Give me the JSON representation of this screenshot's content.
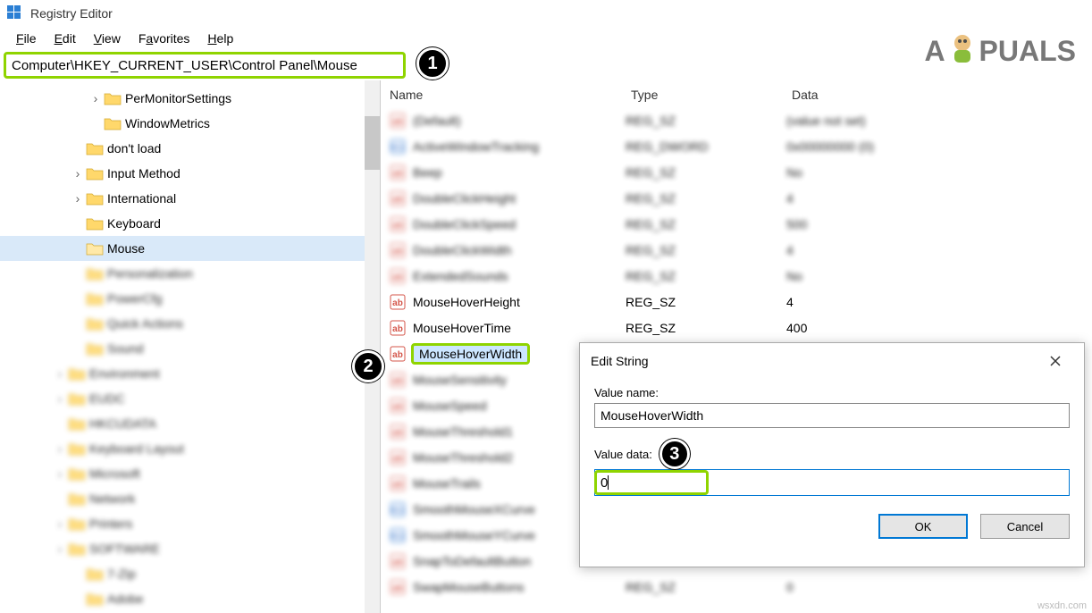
{
  "app": {
    "title": "Registry Editor",
    "address": "Computer\\HKEY_CURRENT_USER\\Control Panel\\Mouse"
  },
  "menu": {
    "file": "File",
    "edit": "Edit",
    "view": "View",
    "favorites": "Favorites",
    "help": "Help"
  },
  "tree": {
    "items": [
      {
        "label": "PerMonitorSettings",
        "indent": 100,
        "expandable": true
      },
      {
        "label": "WindowMetrics",
        "indent": 100
      },
      {
        "label": "don't load",
        "indent": 80
      },
      {
        "label": "Input Method",
        "indent": 80,
        "expandable": true
      },
      {
        "label": "International",
        "indent": 80,
        "expandable": true
      },
      {
        "label": "Keyboard",
        "indent": 80
      },
      {
        "label": "Mouse",
        "indent": 80,
        "selected": true
      },
      {
        "label": "Personalization",
        "indent": 80,
        "blurred": true
      },
      {
        "label": "PowerCfg",
        "indent": 80,
        "blurred": true
      },
      {
        "label": "Quick Actions",
        "indent": 80,
        "blurred": true
      },
      {
        "label": "Sound",
        "indent": 80,
        "blurred": true
      },
      {
        "label": "Environment",
        "indent": 60,
        "blurred": true,
        "expandable": true
      },
      {
        "label": "EUDC",
        "indent": 60,
        "blurred": true,
        "expandable": true
      },
      {
        "label": "HKCUDATA",
        "indent": 60,
        "blurred": true
      },
      {
        "label": "Keyboard Layout",
        "indent": 60,
        "blurred": true,
        "expandable": true
      },
      {
        "label": "Microsoft",
        "indent": 60,
        "blurred": true,
        "expandable": true
      },
      {
        "label": "Network",
        "indent": 60,
        "blurred": true
      },
      {
        "label": "Printers",
        "indent": 60,
        "blurred": true,
        "expandable": true
      },
      {
        "label": "SOFTWARE",
        "indent": 60,
        "blurred": true,
        "expandable": true
      },
      {
        "label": "7-Zip",
        "indent": 80,
        "blurred": true
      },
      {
        "label": "Adobe",
        "indent": 80,
        "blurred": true
      }
    ]
  },
  "list": {
    "headers": {
      "name": "Name",
      "type": "Type",
      "data": "Data"
    },
    "rows": [
      {
        "name_blur": "(Default)",
        "type_blur": "REG_SZ",
        "data_blur": "(value not set)",
        "icon": "ab"
      },
      {
        "name_blur": "ActiveWindowTracking",
        "type_blur": "REG_DWORD",
        "data_blur": "0x00000000 (0)",
        "icon": "bin"
      },
      {
        "name_blur": "Beep",
        "type_blur": "REG_SZ",
        "data_blur": "No",
        "icon": "ab"
      },
      {
        "name_blur": "DoubleClickHeight",
        "type_blur": "REG_SZ",
        "data_blur": "4",
        "icon": "ab"
      },
      {
        "name_blur": "DoubleClickSpeed",
        "type_blur": "REG_SZ",
        "data_blur": "500",
        "icon": "ab"
      },
      {
        "name_blur": "DoubleClickWidth",
        "type_blur": "REG_SZ",
        "data_blur": "4",
        "icon": "ab"
      },
      {
        "name_blur": "ExtendedSounds",
        "type_blur": "REG_SZ",
        "data_blur": "No",
        "icon": "ab"
      },
      {
        "name": "MouseHoverHeight",
        "type": "REG_SZ",
        "data": "4",
        "icon": "ab"
      },
      {
        "name": "MouseHoverTime",
        "type": "REG_SZ",
        "data": "400",
        "icon": "ab"
      },
      {
        "name": "MouseHoverWidth",
        "icon": "ab",
        "highlighted": true
      },
      {
        "name_blur": "MouseSensitivity",
        "icon": "ab"
      },
      {
        "name_blur": "MouseSpeed",
        "icon": "ab"
      },
      {
        "name_blur": "MouseThreshold1",
        "icon": "ab"
      },
      {
        "name_blur": "MouseThreshold2",
        "icon": "ab"
      },
      {
        "name_blur": "MouseTrails",
        "icon": "ab"
      },
      {
        "name_blur": "SmoothMouseXCurve",
        "icon": "bin"
      },
      {
        "name_blur": "SmoothMouseYCurve",
        "icon": "bin"
      },
      {
        "name_blur": "SnapToDefaultButton",
        "icon": "ab"
      },
      {
        "name_blur": "SwapMouseButtons",
        "icon": "ab",
        "type_blur": "REG_SZ",
        "data_blur": "0"
      }
    ]
  },
  "dialog": {
    "title": "Edit String",
    "value_name_label": "Value name:",
    "value_name": "MouseHoverWidth",
    "value_data_label": "Value data:",
    "value_data": "0",
    "ok": "OK",
    "cancel": "Cancel"
  },
  "watermark": {
    "text_a": "A",
    "text_b": "PUALS"
  },
  "srcwm": "wsxdn.com",
  "steps": {
    "s1": "1",
    "s2": "2",
    "s3": "3"
  }
}
